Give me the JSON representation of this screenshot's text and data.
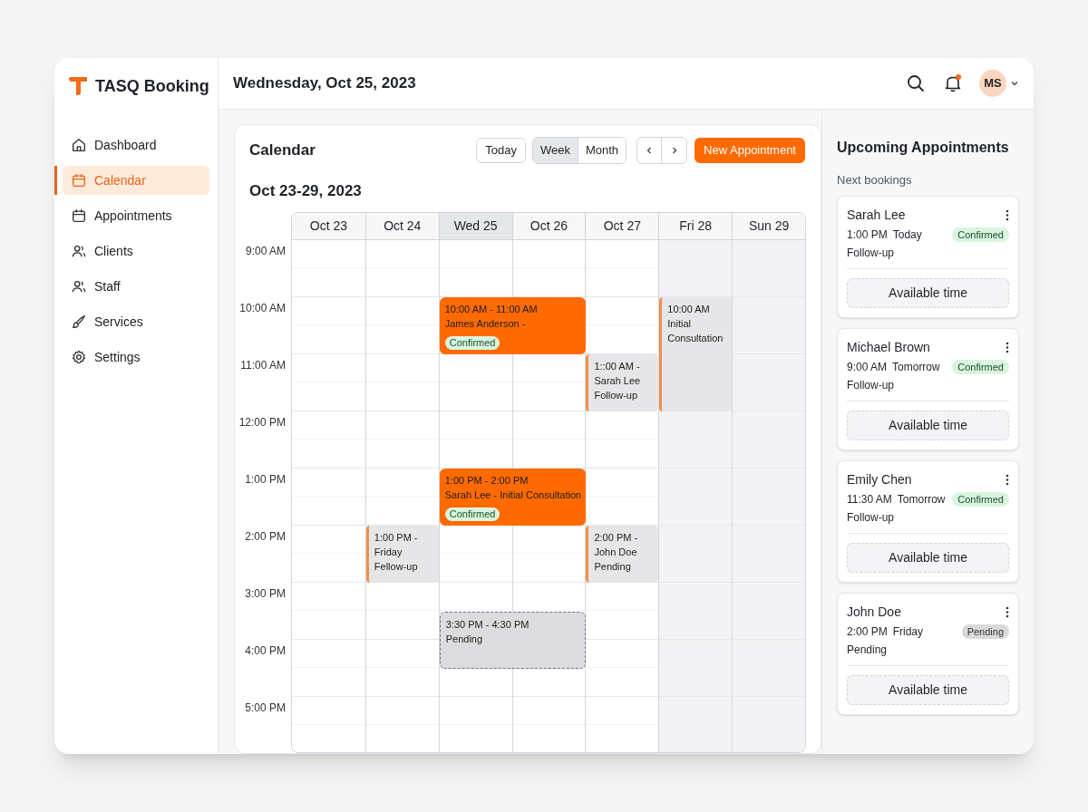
{
  "sidebar": {
    "brand": "TASQ Booking",
    "items": [
      {
        "label": "Dashboard",
        "selected": false
      },
      {
        "label": "Calendar",
        "selected": true
      },
      {
        "label": "Appointments",
        "selected": false
      },
      {
        "label": "Clients",
        "selected": false
      },
      {
        "label": "Staff",
        "selected": false
      },
      {
        "label": "Services",
        "selected": false
      },
      {
        "label": "Settings",
        "selected": false
      }
    ]
  },
  "header": {
    "title": "Wednesday, Oct 25, 2023",
    "notification": true,
    "avatar": "MS"
  },
  "calendar": {
    "title": "Calendar",
    "range": "Oct 23-29, 2023",
    "toolbar": {
      "today": "Today",
      "views": [
        {
          "label": "Week",
          "selected": true
        },
        {
          "label": "Month",
          "selected": false
        }
      ],
      "new_button": "New Appointment"
    },
    "time_labels": [
      "9:00 AM",
      "10:00 AM",
      "11:00 AM",
      "12:00 PM",
      "1:00 PM",
      "2:00 PM",
      "3:00 PM",
      "4:00 PM",
      "5:00 PM"
    ],
    "days": [
      {
        "label": "Oct 23",
        "today": false,
        "shaded": false
      },
      {
        "label": "Oct 24",
        "today": false,
        "shaded": false,
        "events": [
          {
            "kind": "booked",
            "lines": [
              "1:00 PM -",
              "Friday",
              "Fellow-up"
            ]
          }
        ]
      },
      {
        "label": "Wed 25",
        "today": true,
        "shaded": false,
        "events": [
          {
            "kind": "confirmed",
            "lines": [
              "10:00 AM - 11:00 AM",
              "James Anderson -"
            ],
            "badge": "Confirmed"
          },
          {
            "kind": "confirmed",
            "lines": [
              "1:00 PM - 2:00 PM",
              "Sarah Lee - Initial Consultation"
            ],
            "badge": "Confirmed"
          },
          {
            "kind": "tentative",
            "lines": [
              "3:30 PM - 4:30 PM",
              "Pending"
            ]
          }
        ]
      },
      {
        "label": "Oct 26",
        "today": false,
        "shaded": false
      },
      {
        "label": "Oct 27",
        "today": false,
        "shaded": false,
        "events": [
          {
            "kind": "booked",
            "lines": [
              "1::00 AM -",
              "Sarah Lee",
              "Follow-up"
            ]
          },
          {
            "kind": "booked",
            "lines": [
              "2:00 PM -",
              "John Doe",
              "Pending"
            ]
          }
        ]
      },
      {
        "label": "Fri 28",
        "today": false,
        "shaded": true,
        "events": [
          {
            "kind": "booked",
            "lines": [
              "10:00 AM",
              "Initial Consultation"
            ]
          }
        ]
      },
      {
        "label": "Sun 29",
        "today": false,
        "shaded": true
      }
    ]
  },
  "upcoming": {
    "title": "Upcoming Appointments",
    "subtitle": "Next bookings",
    "items": [
      {
        "name": "Sarah Lee",
        "time": "1:00 PM",
        "day": "Today",
        "status": "Confirmed",
        "kind": "confirmed",
        "type": "Follow-up",
        "action": "Available time"
      },
      {
        "name": "Michael Brown",
        "time": "9:00 AM",
        "day": "Tomorrow",
        "status": "Confirmed",
        "kind": "confirmed",
        "type": "Follow-up",
        "action": "Available time"
      },
      {
        "name": "Emily Chen",
        "time": "11:30 AM",
        "day": "Tomorrow",
        "status": "Confirmed",
        "kind": "confirmed",
        "type": "Follow-up",
        "action": "Available time"
      },
      {
        "name": "John Doe",
        "time": "2:00 PM",
        "day": "Friday",
        "status": "Pending",
        "kind": "pending",
        "type": "Pending",
        "action": "Available time"
      }
    ]
  }
}
